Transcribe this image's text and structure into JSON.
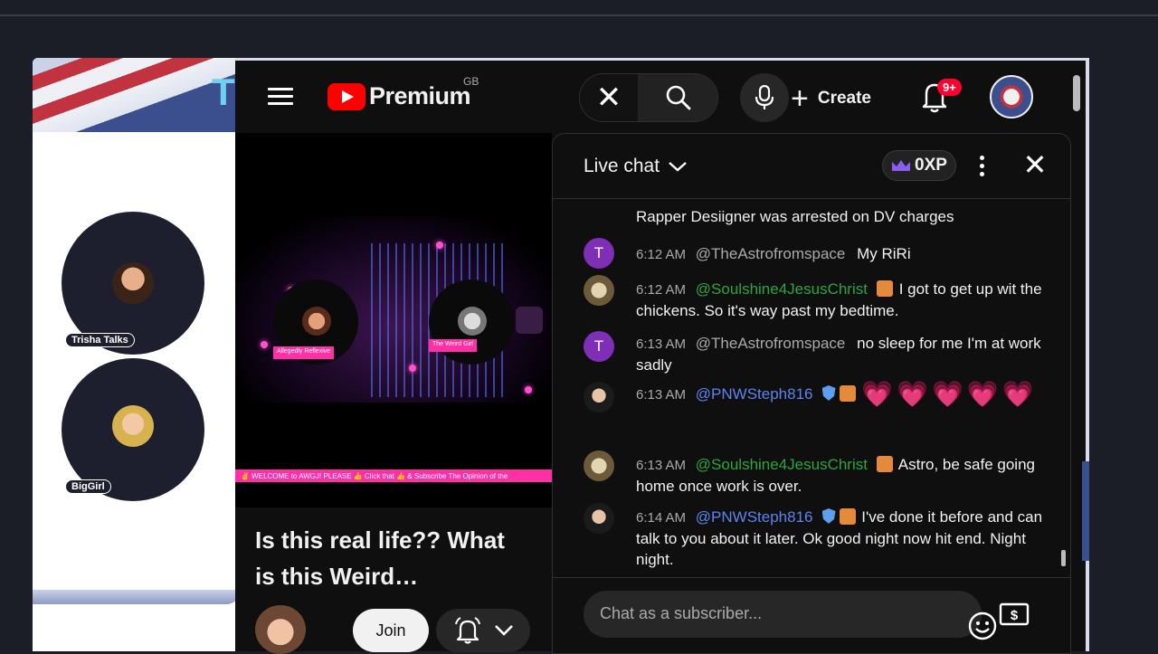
{
  "stream": {
    "guests": [
      {
        "name": "Trisha Talks"
      },
      {
        "name": "BigGirl"
      }
    ],
    "banner_letter": "T"
  },
  "header": {
    "brand": "Premium",
    "country_code": "GB",
    "create_label": "Create",
    "notification_count": "9+"
  },
  "video": {
    "title": "Is this real life?? What is this Weird…",
    "join_label": "Join",
    "overlay_tags": [
      "Allegedly Reflexive",
      "The Weird Girl"
    ],
    "ticker": "✌️ WELCOME to AWGJ! PLEASE 👍 Click that 👍 & Subscribe    The Opinion of the"
  },
  "chat": {
    "title": "Live chat",
    "xp": "0XP",
    "input_placeholder": "Chat as a subscriber...",
    "messages": [
      {
        "time": "",
        "author": "",
        "text": "Rapper Desiigner was arrested on DV charges"
      },
      {
        "time": "6:12 AM",
        "author": "@TheAstrofromspace",
        "text": "My RiRi"
      },
      {
        "time": "6:12 AM",
        "author": "@Soulshine4JesusChrist",
        "text": "I got to get up wit the chickens. So it's way past my bedtime."
      },
      {
        "time": "6:13 AM",
        "author": "@TheAstrofromspace",
        "text": "no sleep for me I'm at work sadly"
      },
      {
        "time": "6:13 AM",
        "author": "@PNWSteph816",
        "text": "💗💗💗💗💗"
      },
      {
        "time": "6:13 AM",
        "author": "@Soulshine4JesusChrist",
        "text": "Astro, be safe going home once work is over."
      },
      {
        "time": "6:14 AM",
        "author": "@PNWSteph816",
        "text": "I've done it before and can talk to you about it later. Ok good night now hit end. Night night."
      }
    ]
  },
  "colors": {
    "background": "#1b1e27",
    "youtube_red": "#ff0000",
    "member_green": "#2ba640",
    "moderator_blue": "#5e84f1",
    "overlay_pink": "#ff2fa6"
  }
}
